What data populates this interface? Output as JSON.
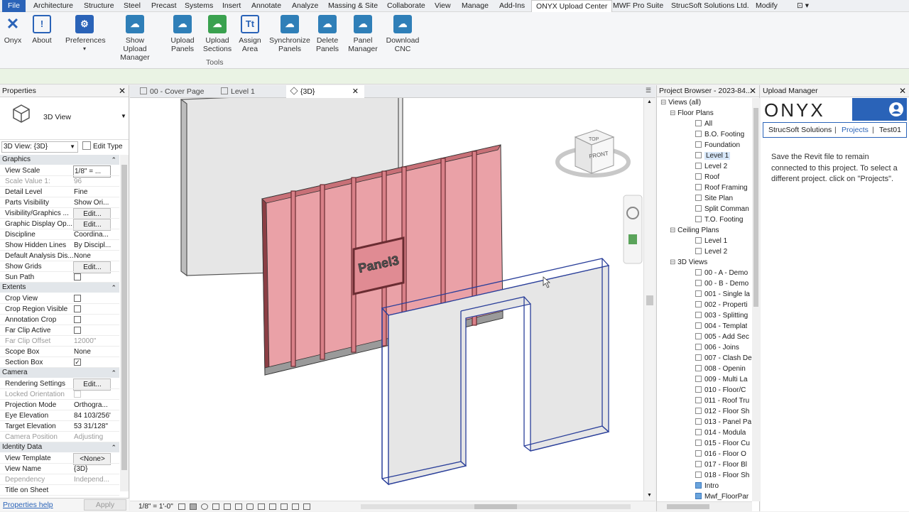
{
  "ribbon_tabs": [
    "File",
    "Architecture",
    "Structure",
    "Steel",
    "Precast",
    "Systems",
    "Insert",
    "Annotate",
    "Analyze",
    "Massing & Site",
    "Collaborate",
    "View",
    "Manage",
    "Add-Ins",
    "ONYX Upload Center",
    "MWF Pro Suite",
    "StrucSoft Solutions Ltd.",
    "Modify"
  ],
  "ribbon_buttons": [
    {
      "label": "Onyx",
      "icon": "onyx-x-icon"
    },
    {
      "label": "About",
      "icon": "info-icon"
    },
    {
      "label": "Preferences",
      "icon": "gear-icon"
    },
    {
      "label": "Show\nUpload Manager",
      "icon": "cloud-upload-icon"
    },
    {
      "label": "Upload\nPanels",
      "icon": "cloud-upload-icon"
    },
    {
      "label": "Upload\nSections",
      "icon": "cloud-upload-green-icon"
    },
    {
      "label": "Assign\nArea",
      "icon": "text-area-icon"
    },
    {
      "label": "Synchronize\nPanels",
      "icon": "cloud-sync-icon"
    },
    {
      "label": "Delete\nPanels",
      "icon": "cloud-delete-icon"
    },
    {
      "label": "Panel\nManager",
      "icon": "cloud-upload-icon"
    },
    {
      "label": "Download\nCNC",
      "icon": "cloud-download-icon"
    }
  ],
  "ribbon_group": "Tools",
  "properties": {
    "title": "Properties",
    "type_name": "3D View",
    "instance_selector": "3D View: {3D}",
    "edit_type": "Edit Type",
    "sections": [
      {
        "name": "Graphics",
        "rows": [
          {
            "k": "View Scale",
            "v": "1/8\" = ...",
            "box": true
          },
          {
            "k": "Scale Value    1:",
            "v": "96",
            "grey": true
          },
          {
            "k": "Detail Level",
            "v": "Fine"
          },
          {
            "k": "Parts Visibility",
            "v": "Show Ori..."
          },
          {
            "k": "Visibility/Graphics ...",
            "v": "Edit...",
            "btn": true
          },
          {
            "k": "Graphic Display Op...",
            "v": "Edit...",
            "btn": true
          },
          {
            "k": "Discipline",
            "v": "Coordina..."
          },
          {
            "k": "Show Hidden Lines",
            "v": "By Discipl..."
          },
          {
            "k": "Default Analysis Dis...",
            "v": "None"
          },
          {
            "k": "Show Grids",
            "v": "Edit...",
            "btn": true
          },
          {
            "k": "Sun Path",
            "v": "",
            "chk": false
          }
        ]
      },
      {
        "name": "Extents",
        "rows": [
          {
            "k": "Crop View",
            "v": "",
            "chk": false
          },
          {
            "k": "Crop Region Visible",
            "v": "",
            "chk": false
          },
          {
            "k": "Annotation Crop",
            "v": "",
            "chk": false
          },
          {
            "k": "Far Clip Active",
            "v": "",
            "chk": false
          },
          {
            "k": "Far Clip Offset",
            "v": "12000\"",
            "grey": true
          },
          {
            "k": "Scope Box",
            "v": "None"
          },
          {
            "k": "Section Box",
            "v": "",
            "chk": true
          }
        ]
      },
      {
        "name": "Camera",
        "rows": [
          {
            "k": "Rendering Settings",
            "v": "Edit...",
            "btn": true
          },
          {
            "k": "Locked Orientation",
            "v": "",
            "grey": true,
            "chk": false
          },
          {
            "k": "Projection Mode",
            "v": "Orthogra..."
          },
          {
            "k": "Eye Elevation",
            "v": "84 103/256\""
          },
          {
            "k": "Target Elevation",
            "v": "53 31/128\""
          },
          {
            "k": "Camera Position",
            "v": "Adjusting",
            "grey": true
          }
        ]
      },
      {
        "name": "Identity Data",
        "rows": [
          {
            "k": "View Template",
            "v": "<None>",
            "btn": true
          },
          {
            "k": "View Name",
            "v": "{3D}"
          },
          {
            "k": "Dependency",
            "v": "Independ...",
            "grey": true
          },
          {
            "k": "Title on Sheet",
            "v": ""
          }
        ]
      }
    ],
    "help_link": "Properties help",
    "apply": "Apply"
  },
  "view_tabs": [
    {
      "label": "00 - Cover Page"
    },
    {
      "label": "Level 1"
    },
    {
      "label": "{3D}",
      "active": true
    }
  ],
  "viewport": {
    "panel_label": "Panel3",
    "viewcube_top": "TOP",
    "viewcube_front": "FRONT",
    "scale": "1/8\" = 1'-0\""
  },
  "project_browser": {
    "title": "Project Browser - 2023-84...",
    "items": [
      {
        "t": "Views (all)",
        "lvl": 0,
        "exp": true
      },
      {
        "t": "Floor Plans",
        "lvl": 1,
        "exp": true
      },
      {
        "t": "All",
        "lvl": 2
      },
      {
        "t": "B.O. Footing",
        "lvl": 2
      },
      {
        "t": "Foundation",
        "lvl": 2
      },
      {
        "t": "Level 1",
        "lvl": 2,
        "sel": true
      },
      {
        "t": "Level 2",
        "lvl": 2
      },
      {
        "t": "Roof",
        "lvl": 2
      },
      {
        "t": "Roof Framing",
        "lvl": 2
      },
      {
        "t": "Site Plan",
        "lvl": 2
      },
      {
        "t": "Split Comman",
        "lvl": 2
      },
      {
        "t": "T.O. Footing",
        "lvl": 2
      },
      {
        "t": "Ceiling Plans",
        "lvl": 1,
        "exp": true
      },
      {
        "t": "Level 1",
        "lvl": 2
      },
      {
        "t": "Level 2",
        "lvl": 2
      },
      {
        "t": "3D Views",
        "lvl": 1,
        "exp": true
      },
      {
        "t": "00 - A - Demo",
        "lvl": 2
      },
      {
        "t": "00 - B - Demo",
        "lvl": 2
      },
      {
        "t": "001 - Single la",
        "lvl": 2
      },
      {
        "t": "002 - Properti",
        "lvl": 2
      },
      {
        "t": "003 - Splitting",
        "lvl": 2
      },
      {
        "t": "004 - Templat",
        "lvl": 2
      },
      {
        "t": "005 - Add Sec",
        "lvl": 2
      },
      {
        "t": "006 - Joins",
        "lvl": 2
      },
      {
        "t": "007 - Clash De",
        "lvl": 2
      },
      {
        "t": "008 - Openin",
        "lvl": 2
      },
      {
        "t": "009 - Multi La",
        "lvl": 2
      },
      {
        "t": "010 - Floor/C",
        "lvl": 2
      },
      {
        "t": "011 - Roof Tru",
        "lvl": 2
      },
      {
        "t": "012 - Floor Sh",
        "lvl": 2
      },
      {
        "t": "013 - Panel Pa",
        "lvl": 2
      },
      {
        "t": "014 - Modula",
        "lvl": 2
      },
      {
        "t": "015 - Floor Cu",
        "lvl": 2
      },
      {
        "t": "016 - Floor O",
        "lvl": 2
      },
      {
        "t": "017 - Floor Bl",
        "lvl": 2
      },
      {
        "t": "018 - Floor Sh",
        "lvl": 2
      },
      {
        "t": "Intro",
        "lvl": 2,
        "blue": true
      },
      {
        "t": "Mwf_FloorPar",
        "lvl": 2,
        "blue": true
      }
    ]
  },
  "upload_manager": {
    "title": "Upload Manager",
    "logo": "ONYX",
    "tabs": [
      "StrucSoft Solutions",
      "Projects",
      "Test01"
    ],
    "message": "Save the Revit file to remain connected to this project. To select a different project. click on \"Projects\"."
  },
  "colors": {
    "accent": "#2a63b8",
    "wall_fill": "#e8959b",
    "wall_frame": "#b8595f",
    "opening_stroke": "#2a3f9a"
  }
}
